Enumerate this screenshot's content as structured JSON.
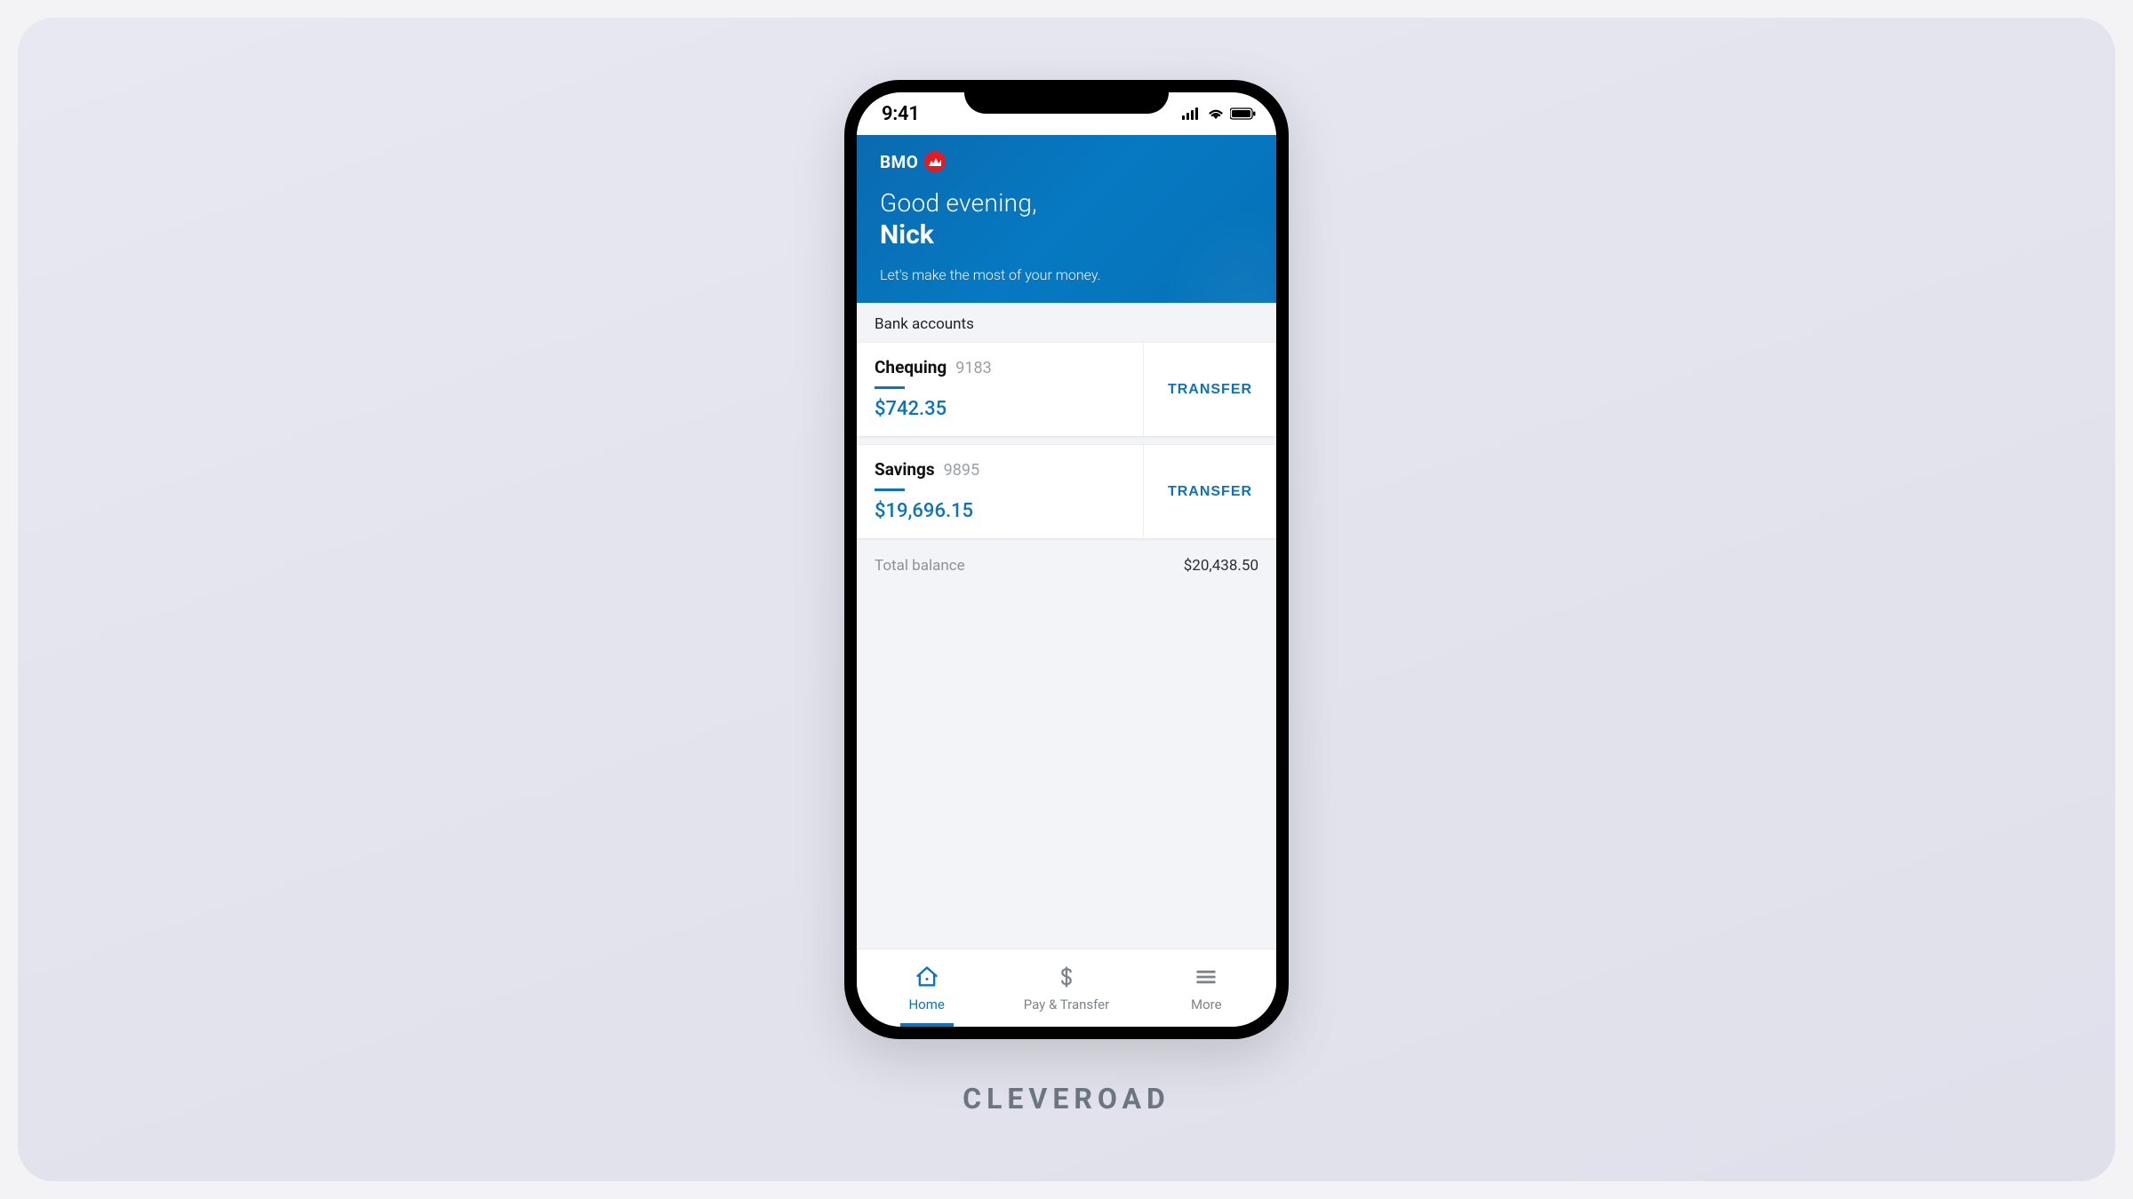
{
  "status": {
    "time": "9:41"
  },
  "brand": {
    "name": "BMO"
  },
  "hero": {
    "greeting": "Good evening,",
    "name": "Nick",
    "tagline": "Let's make the most of your money."
  },
  "accounts": {
    "section_label": "Bank accounts",
    "items": [
      {
        "name": "Chequing",
        "number": "9183",
        "balance": "$742.35",
        "action_label": "TRANSFER"
      },
      {
        "name": "Savings",
        "number": "9895",
        "balance": "$19,696.15",
        "action_label": "TRANSFER"
      }
    ],
    "total_label": "Total balance",
    "total_value": "$20,438.50"
  },
  "tabs": {
    "home": "Home",
    "pay": "Pay & Transfer",
    "more": "More"
  },
  "caption": "CLEVEROAD",
  "colors": {
    "accent": "#0b74bc",
    "brand_red": "#e31b23"
  }
}
